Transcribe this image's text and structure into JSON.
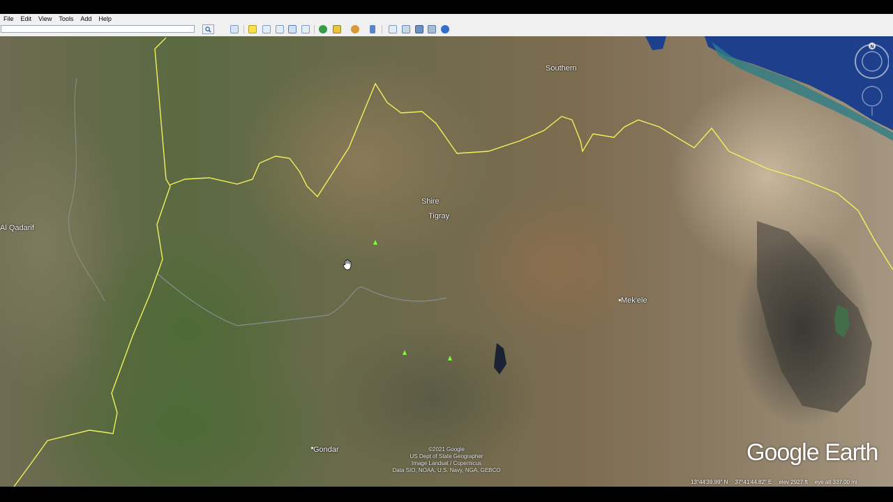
{
  "menu": {
    "items": [
      {
        "label": "File"
      },
      {
        "label": "Edit"
      },
      {
        "label": "View"
      },
      {
        "label": "Tools"
      },
      {
        "label": "Add"
      },
      {
        "label": "Help"
      }
    ]
  },
  "search": {
    "value": "",
    "placeholder": ""
  },
  "toolbar": {
    "icons": [
      "search-icon",
      "sidebar-toggle-icon",
      "placemark-icon",
      "polygon-icon",
      "path-icon",
      "image-overlay-icon",
      "record-tour-icon",
      "historical-imagery-icon",
      "sunlight-icon",
      "planets-icon",
      "ruler-icon",
      "email-icon",
      "print-icon",
      "save-image-icon",
      "maps-icon",
      "earth-icon"
    ]
  },
  "map": {
    "labels": {
      "southern": "Southern",
      "shire": "Shire",
      "tigray": "Tigray",
      "al_qadarif": "Al Qadarif",
      "mekele": "Mek'ele",
      "gondar": "Gondar"
    },
    "attribution": [
      "©2021 Google",
      "US Dept of State Geographer",
      "Image Landsat / Copernicus",
      "Data SIO, NOAA, U.S. Navy, NGA, GEBCO"
    ],
    "logo": "Google Earth",
    "compass_north": "N",
    "status": {
      "lat": "13°44'39.99\" N",
      "lon": "37°41'44.82\" E",
      "elev": "elev  2927 ft",
      "eye_alt": "eye alt 337.00 mi"
    },
    "colors": {
      "border_yellow": "#f2f25a",
      "sea_blue": "#1d3f8c",
      "lake_green": "#4fae5b"
    }
  }
}
